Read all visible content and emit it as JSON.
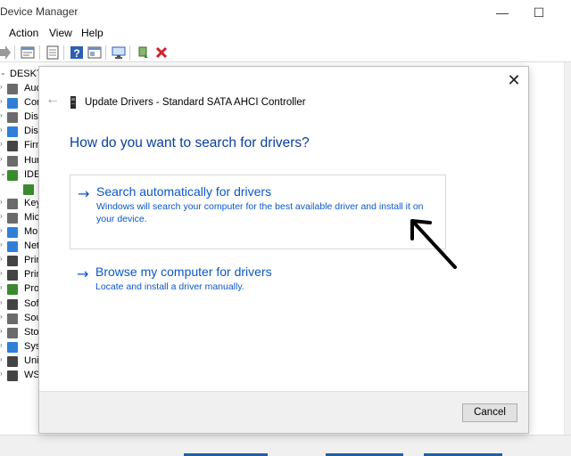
{
  "window": {
    "title": "Device Manager",
    "minimize_glyph": "—",
    "maximize_glyph": "☐"
  },
  "menu": [
    "Action",
    "View",
    "Help"
  ],
  "toolbar_icons": [
    "back-icon",
    "properties-icon",
    "show-hidden-icon",
    "help-icon",
    "view-icon",
    "scan-hardware-icon",
    "add-driver-icon",
    "uninstall-icon"
  ],
  "tree": {
    "root": "DESKTO",
    "items": [
      {
        "label": "Auc",
        "icon": "audio-icon",
        "color": "#6b6b6b"
      },
      {
        "label": "Con",
        "icon": "computer-icon",
        "color": "#2f7fd6"
      },
      {
        "label": "Disk",
        "icon": "disk-icon",
        "color": "#6b6b6b"
      },
      {
        "label": "Disp",
        "icon": "display-icon",
        "color": "#2f7fd6"
      },
      {
        "label": "Firm",
        "icon": "firmware-icon",
        "color": "#444"
      },
      {
        "label": "Hun",
        "icon": "hid-icon",
        "color": "#6b6b6b"
      },
      {
        "label": "IDE",
        "icon": "ide-icon",
        "color": "#3b8a2f"
      },
      {
        "label": "",
        "icon": "ide-child-icon",
        "color": "#3b8a2f"
      },
      {
        "label": "Key",
        "icon": "keyboard-icon",
        "color": "#6b6b6b"
      },
      {
        "label": "Mic",
        "icon": "mouse-icon",
        "color": "#6b6b6b"
      },
      {
        "label": "Mo",
        "icon": "monitor-icon",
        "color": "#2f7fd6"
      },
      {
        "label": "Net",
        "icon": "network-icon",
        "color": "#2f7fd6"
      },
      {
        "label": "Prin",
        "icon": "print-queue-icon",
        "color": "#444"
      },
      {
        "label": "Prin",
        "icon": "printer-icon",
        "color": "#444"
      },
      {
        "label": "Pro",
        "icon": "processor-icon",
        "color": "#3b8a2f"
      },
      {
        "label": "Sof",
        "icon": "software-icon",
        "color": "#444"
      },
      {
        "label": "Sou",
        "icon": "sound-icon",
        "color": "#6b6b6b"
      },
      {
        "label": "Sto",
        "icon": "storage-icon",
        "color": "#6b6b6b"
      },
      {
        "label": "Syst",
        "icon": "system-icon",
        "color": "#2f7fd6"
      },
      {
        "label": "Uni",
        "icon": "usb-icon",
        "color": "#444"
      },
      {
        "label": "WS",
        "icon": "wsd-icon",
        "color": "#444"
      }
    ]
  },
  "dialog": {
    "close_glyph": "✕",
    "back_glyph": "←",
    "header_title": "Update Drivers - Standard SATA AHCI Controller",
    "question": "How do you want to search for drivers?",
    "options": [
      {
        "arrow": "→",
        "title": "Search automatically for drivers",
        "description": "Windows will search your computer for the best available driver and install it on your device."
      },
      {
        "arrow": "→",
        "title": "Browse my computer for drivers",
        "description": "Locate and install a driver manually."
      }
    ],
    "cancel_label": "Cancel"
  },
  "colors": {
    "accent": "#0a58c7",
    "question": "#0a3fa0",
    "footer_bg": "#f0f0f0"
  }
}
